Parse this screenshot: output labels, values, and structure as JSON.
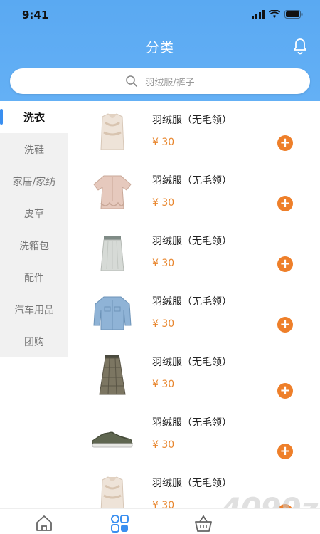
{
  "status": {
    "time": "9:41"
  },
  "header": {
    "title": "分类"
  },
  "search": {
    "placeholder": "羽绒服/裤子"
  },
  "sidebar": {
    "items": [
      {
        "label": "洗衣",
        "active": true
      },
      {
        "label": "洗鞋"
      },
      {
        "label": "家居/家纺"
      },
      {
        "label": "皮草"
      },
      {
        "label": "洗箱包"
      },
      {
        "label": "配件"
      },
      {
        "label": "汽车用品"
      },
      {
        "label": "团购"
      }
    ]
  },
  "products": [
    {
      "name": "羽绒服（无毛领）",
      "price": "¥ 30",
      "image": "fur-vest"
    },
    {
      "name": "羽绒服（无毛领）",
      "price": "¥ 30",
      "image": "pink-blouse"
    },
    {
      "name": "羽绒服（无毛领）",
      "price": "¥ 30",
      "image": "skirt"
    },
    {
      "name": "羽绒服（无毛领）",
      "price": "¥ 30",
      "image": "denim-jacket"
    },
    {
      "name": "羽绒服（无毛领）",
      "price": "¥ 30",
      "image": "plaid-skirt"
    },
    {
      "name": "羽绒服（无毛领）",
      "price": "¥ 30",
      "image": "sneaker"
    },
    {
      "name": "羽绒服（无毛领）",
      "price": "¥ 30",
      "image": "fur-vest"
    }
  ],
  "watermark": "4099z",
  "colors": {
    "header": "#5aa9f2",
    "accent": "#ee7f2a",
    "active_bar": "#3a8ff0",
    "sidebar_bg": "#f1f1f1"
  },
  "tabbar": {
    "items": [
      "home-icon",
      "category-icon",
      "basket-icon"
    ]
  }
}
